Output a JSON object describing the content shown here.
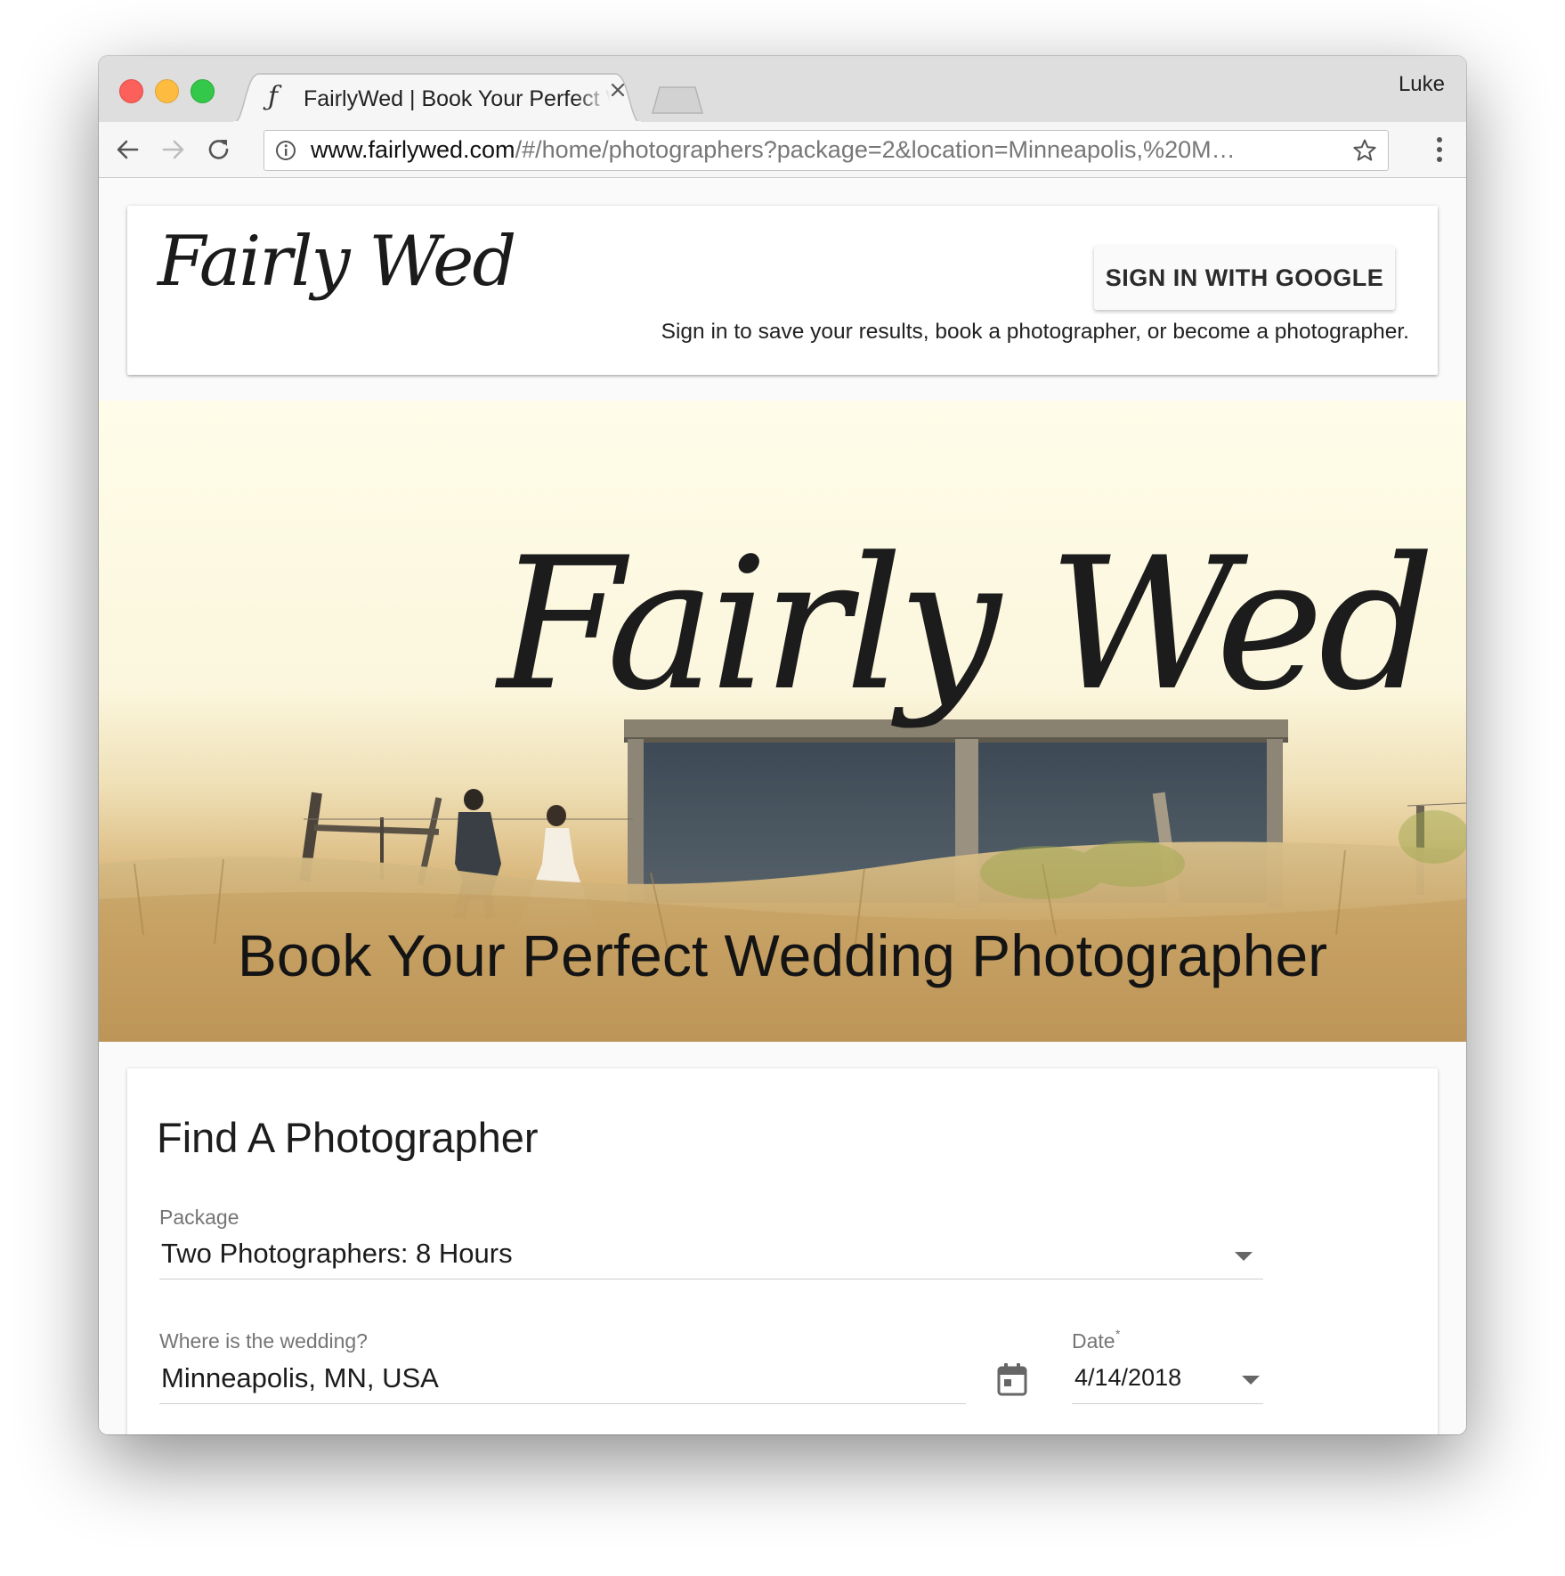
{
  "browser": {
    "tab_favicon": "ƒ",
    "tab_title": "FairlyWed | Book Your Perfect Wedding Photographer",
    "profile_name": "Luke",
    "url_host": "www.fairlywed.com",
    "url_path": "/#/home/photographers?package=2&location=Minneapolis,%20M…"
  },
  "header": {
    "logo_text": "Fairly Wed",
    "signin_button": "SIGN IN WITH GOOGLE",
    "signin_note": "Sign in to save your results, book a photographer, or become a photographer."
  },
  "hero": {
    "logo_text": "Fairly Wed",
    "title": "Book Your Perfect Wedding Photographer"
  },
  "search": {
    "title": "Find A Photographer",
    "package_label": "Package",
    "package_value": "Two Photographers: 8 Hours",
    "location_label": "Where is the wedding?",
    "location_value": "Minneapolis, MN, USA",
    "date_label": "Date",
    "date_required": "*",
    "date_value": "4/14/2018"
  },
  "icons": {
    "back": "arrow-left-icon",
    "forward": "arrow-right-icon",
    "reload": "reload-icon",
    "info": "info-icon",
    "star": "star-icon",
    "menu": "more-vert-icon",
    "calendar": "calendar-icon",
    "tab_close": "close-icon"
  }
}
